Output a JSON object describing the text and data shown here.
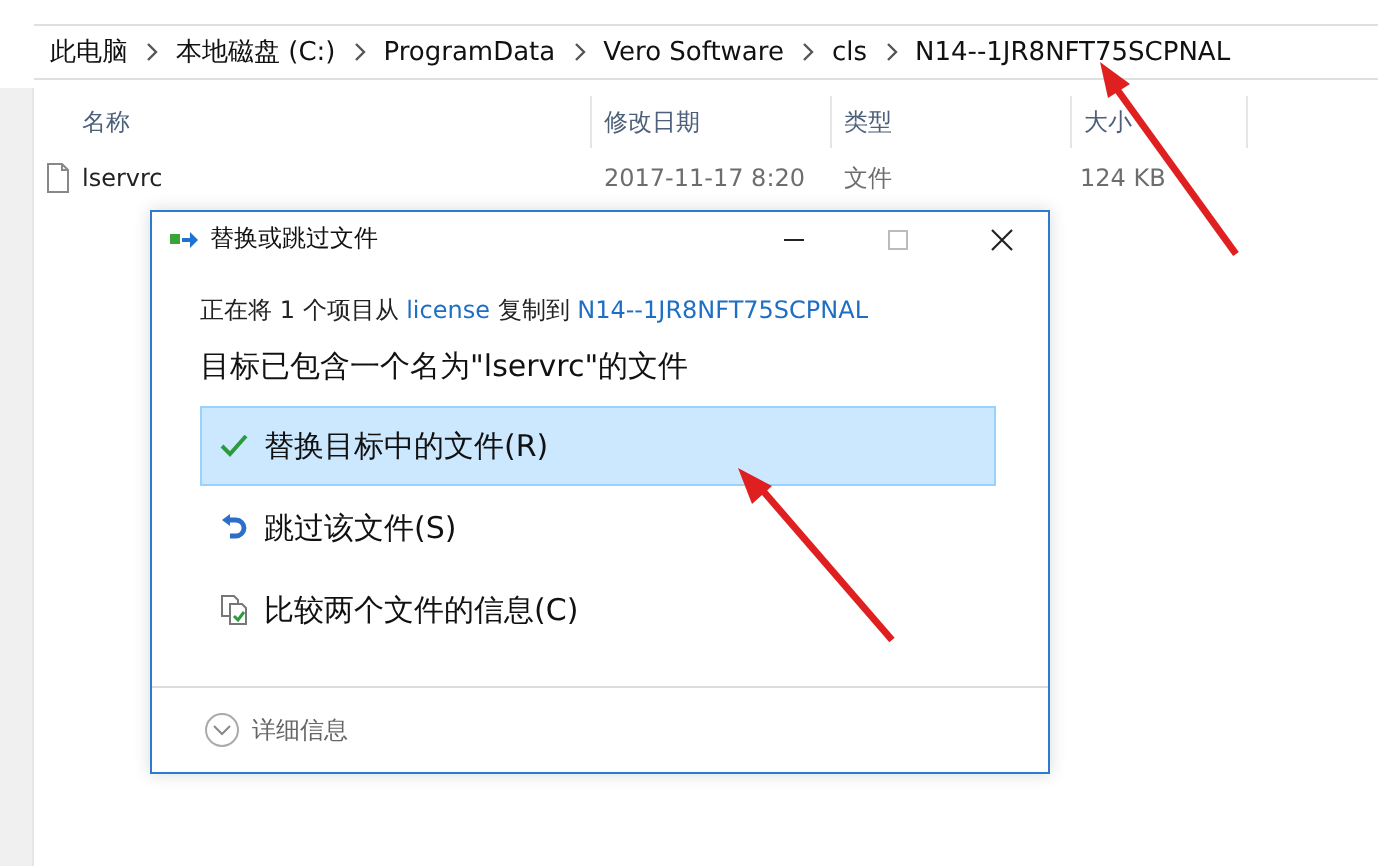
{
  "breadcrumb": [
    "此电脑",
    "本地磁盘 (C:)",
    "ProgramData",
    "Vero Software",
    "cls",
    "N14--1JR8NFT75SCPNAL"
  ],
  "columns": [
    "名称",
    "修改日期",
    "类型",
    "大小"
  ],
  "rows": [
    {
      "cells": [
        "lservrc",
        "2017-11-17 8:20",
        "文件",
        "124 KB"
      ]
    }
  ],
  "dialog": {
    "title": "替换或跳过文件",
    "status": {
      "prefix": "正在将 1 个项目从",
      "source": "license",
      "middle": "复制到",
      "target": "N14--1JR8NFT75SCPNAL"
    },
    "heading": "目标已包含一个名为\"lservrc\"的文件",
    "options": [
      {
        "kind": "replace",
        "label": "替换目标中的文件(R)",
        "selected": true
      },
      {
        "kind": "skip",
        "label": "跳过该文件(S)",
        "selected": false
      },
      {
        "kind": "compare",
        "label": "比较两个文件的信息(C)",
        "selected": false
      }
    ],
    "details": "详细信息"
  }
}
